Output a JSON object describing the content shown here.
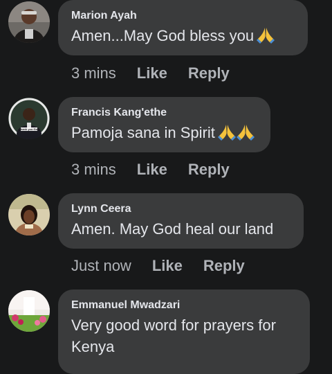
{
  "comments": [
    {
      "author": "Marion Ayah",
      "text": "Amen...May God bless you",
      "emoji_count": 1,
      "time": "3 mins",
      "like_label": "Like",
      "reply_label": "Reply"
    },
    {
      "author": "Francis Kang'ethe",
      "text": "Pamoja sana in Spirit",
      "emoji_count": 2,
      "time": "3 mins",
      "like_label": "Like",
      "reply_label": "Reply",
      "avatar_caption": "Thank you God"
    },
    {
      "author": "Lynn Ceera",
      "text": "Amen. May God heal our land",
      "emoji_count": 0,
      "time": "Just now",
      "like_label": "Like",
      "reply_label": "Reply"
    },
    {
      "author": "Emmanuel Mwadzari",
      "text": "Very good word for prayers for Kenya",
      "emoji_count": 0
    }
  ],
  "icons": {
    "reaction_emoji": "folded-hands-icon"
  },
  "colors": {
    "background": "#18191a",
    "bubble": "#3a3b3c",
    "primary_text": "#e4e6eb",
    "secondary_text": "#b0b3b8"
  }
}
